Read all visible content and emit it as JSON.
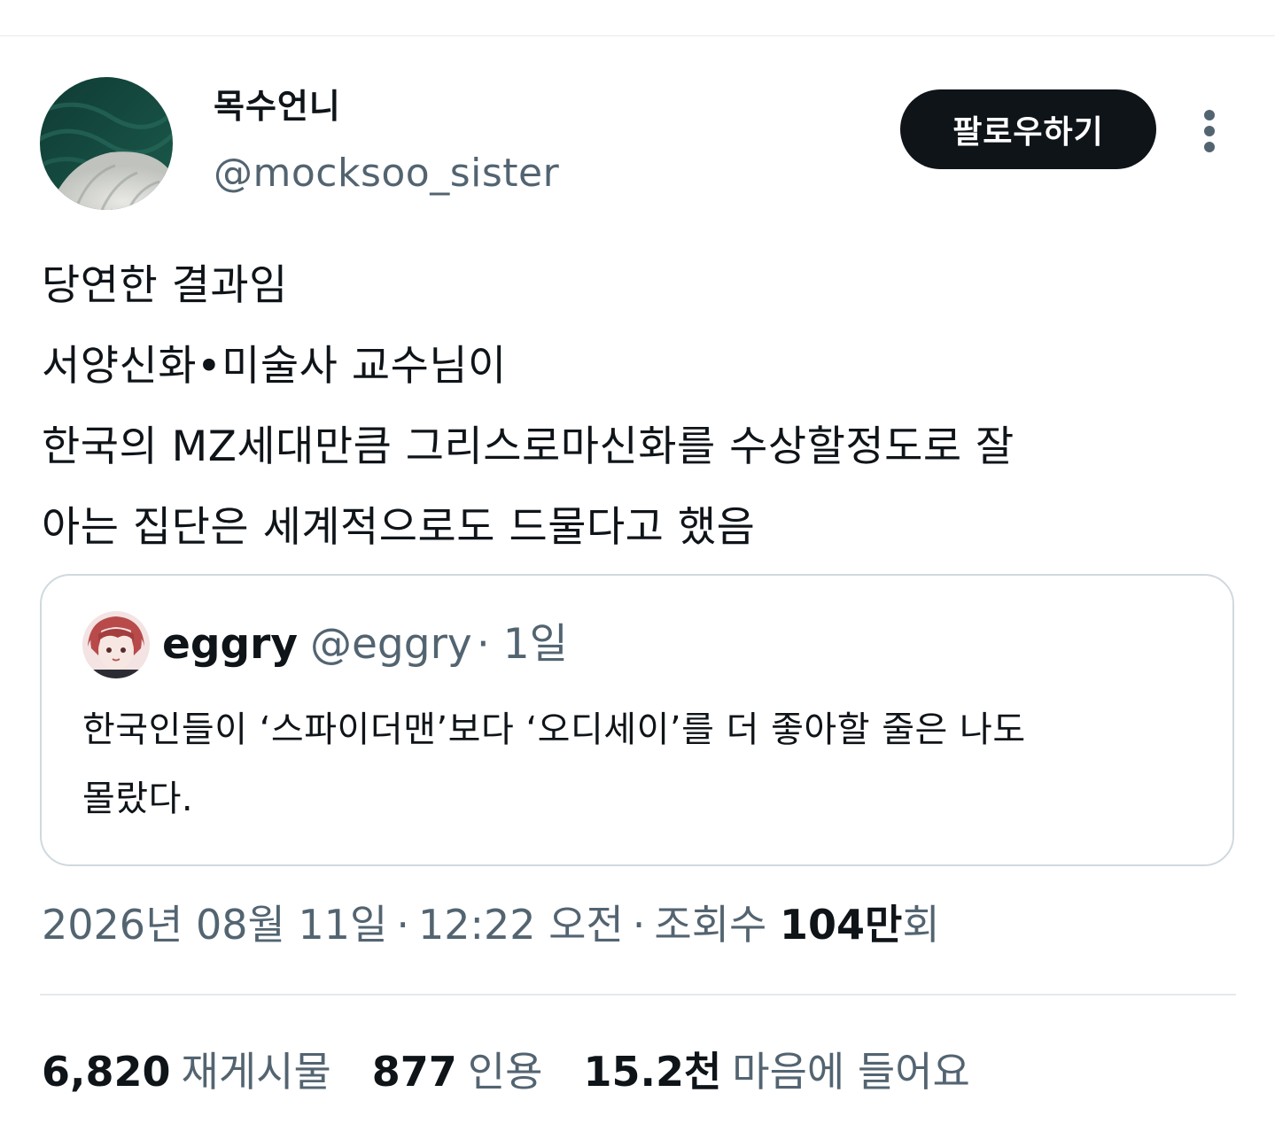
{
  "author": {
    "display_name": "목수언니",
    "handle": "@mocksoo_sister"
  },
  "follow_button_label": "팔로우하기",
  "tweet_text": "당연한 결과임\n서양신화•미술사 교수님이\n한국의 MZ세대만큼 그리스로마신화를 수상할정도로 잘\n아는 집단은 세계적으로도 드물다고 했음",
  "quoted_tweet": {
    "display_name": "eggry",
    "handle": "@eggry",
    "time": "· 1일",
    "text": "한국인들이 ‘스파이더맨’보다 ‘오디세이’를 더 좋아할 줄은 나도\n몰랐다."
  },
  "meta": {
    "date": "2026년 08월 11일",
    "separator": "·",
    "time": "12:22 오전",
    "views_label": "조회수",
    "views_count": "104만",
    "views_suffix": "회"
  },
  "stats": [
    {
      "count": "6,820",
      "label": "재게시물"
    },
    {
      "count": "877",
      "label": "인용"
    },
    {
      "count": "15.2천",
      "label": "마음에 들어요"
    }
  ],
  "colors": {
    "text_primary": "#0f1419",
    "text_secondary": "#536471",
    "border": "#cfd9de",
    "button_bg": "#0f1419"
  },
  "icons": {
    "more": "more-vertical-icon"
  }
}
